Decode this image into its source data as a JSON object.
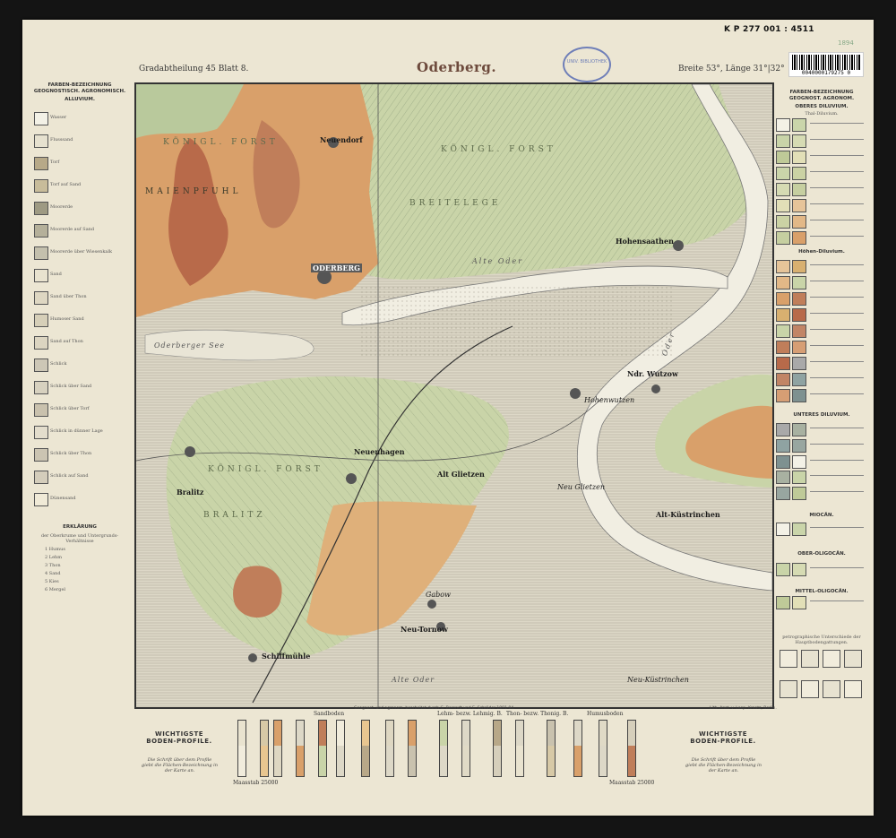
{
  "shelfmark": "K P 277 001 : 4511",
  "barcode_number": "0040000179275 0",
  "pencil_note": "1894",
  "stamp_text": "UNIV. BIBLIOTHEK",
  "header": {
    "left": "Gradabtheilung 45 Blatt 8.",
    "title": "Oderberg.",
    "right": "Breite 53°, Länge 31°|32°"
  },
  "legend_left": {
    "heading1": "FARBEN-BEZEICHNUNG",
    "heading2": "GEOGNOSTISCH.   AGRONOMISCH.",
    "section": "ALLUVIUM.",
    "items": [
      "Wasser",
      "Flusssand",
      "Torf",
      "Torf auf Sand",
      "Moorerde",
      "Moorerde auf Sand",
      "Moorerde über Wiesenkalk",
      "Sand",
      "Sand über Thon",
      "Humoser Sand",
      "Sand auf Thon",
      "Schlick",
      "Schlick über Sand",
      "Schlick über Torf",
      "Schlick in dünner Lage",
      "Schlick über Thon",
      "Schlick auf Sand",
      "Dünensand"
    ],
    "erkl": "ERKLÄRUNG",
    "erkl_sub": "der Oberkrume und Untergrunds-Verhältnisse",
    "notes": [
      "1 Humus",
      "2 Lehm",
      "3 Thon",
      "4 Sand",
      "5 Kies",
      "6 Mergel"
    ]
  },
  "legend_right": {
    "heading1": "FARBEN-BEZEICHNUNG",
    "heading2": "GEOGNOST.   AGRONOM.",
    "section1": "OBERES DILUVIUM.",
    "sub1": "Thal-Diluvium.",
    "section2": "Höhen-Diluvium.",
    "section3": "UNTERES DILUVIUM.",
    "section4": "MIOCÄN.",
    "section5": "OBER-OLIGOCÄN.",
    "section6": "MITTEL-OLIGOCÄN.",
    "footer": "petrographische Unterschiede der Hauptbodengattungen."
  },
  "map_labels": {
    "konigl_forst_nw": "KÖNIGL. FORST",
    "majenpfuhl": "MAIENPFUHL",
    "neuendorf": "Neuendorf",
    "konigl_forst_n": "KÖNIGL. FORST",
    "breitelege": "BREITELEGE",
    "hohensaathen": "Hohensaathen",
    "oderberg": "ODERBERG",
    "alte_oder": "Alte Oder",
    "oderberger_see": "Oderberger See",
    "oder": "Oder",
    "ndr_wutzow": "Ndr. Wutzow",
    "hohenwutzen": "Hohenwutzen",
    "neumhagen": "Neuenhagen",
    "alt_glietzen": "Alt Glietzen",
    "neu_glietzen": "Neu Glietzen",
    "alt_kustrinchen": "Alt-Küstrinchen",
    "konigl_forst_w": "KÖNIGL. FORST",
    "bralitz_town": "Bralitz",
    "bralitz": "BRALITZ",
    "gabow": "Gabow",
    "neu_tornow": "Neu-Tornow",
    "schiffmuhle": "Schiffmühle",
    "alte_oder_s": "Alte Oder",
    "neu_kustrinchen": "Neu-Küstrinchen"
  },
  "bottom": {
    "left_title": "WICHTIGSTE BODEN-PROFILE.",
    "left_note": "Die Schrift über dem Profile giebt die Flächen-Bezeichnung in der Karte an.",
    "right_title": "WICHTIGSTE BODEN-PROFILE.",
    "right_note": "Die Schrift über dem Profile giebt die Flächen-Bezeichnung in der Karte an.",
    "scale_left": "Maasstab 25000",
    "scale_right": "Maasstab 25000",
    "cat_sand": "Sandboden",
    "cat_lehm": "Lehm- bezw. Lehmig. B.",
    "cat_thon": "Thon- bezw. Thonig. B.",
    "cat_humus": "Humusboden",
    "credits": "Geognost. und agronom. bearbeitet durch G. Berendt und E. Schröder 1891-94.",
    "lith": "Lith. Anst. v. Leop. Kraatz, Berlin."
  },
  "colors": {
    "sheet": "#ece6d3",
    "alluvium_grey": "#ddd8c7",
    "diluvium_green": "#c9d4a8",
    "lehm_orange": "#d9a06a",
    "marl_brown": "#b86a4a",
    "water": "#f1eee2"
  }
}
